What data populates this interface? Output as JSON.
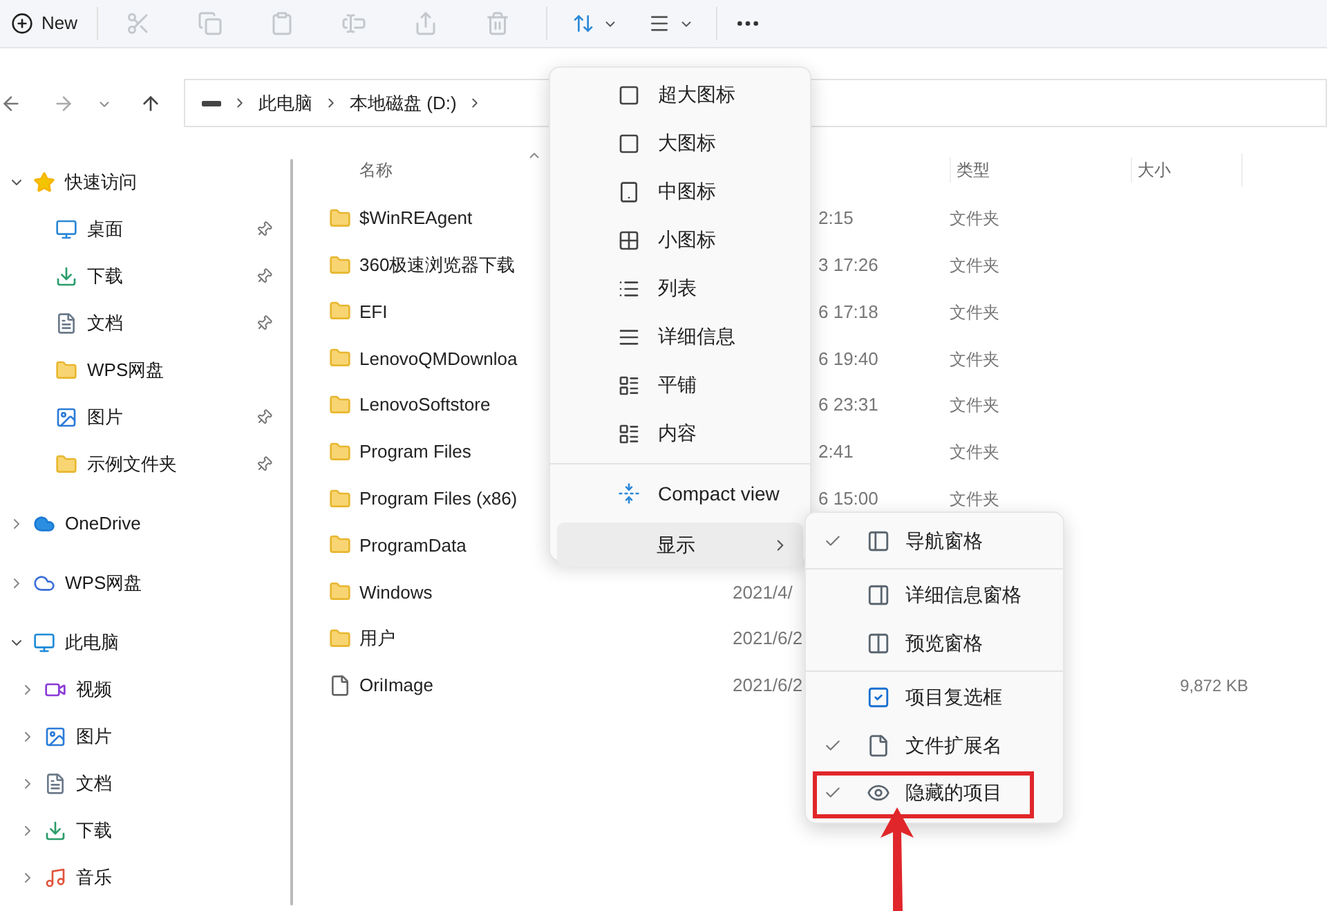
{
  "toolbar": {
    "new_label": "New",
    "tools": [
      {
        "disabled": true
      },
      {
        "disabled": true
      },
      {
        "disabled": true
      },
      {
        "disabled": true
      },
      {
        "disabled": true
      },
      {
        "disabled": true
      }
    ],
    "sort_open": false,
    "view_open": true
  },
  "address": {
    "segments": [
      "此电脑",
      "本地磁盘 (D:)"
    ]
  },
  "sidebar": {
    "items": [
      {
        "label": "快速访问",
        "kind": "star",
        "expanded": true,
        "children": [
          {
            "label": "桌面",
            "kind": "desktop",
            "pinned": true
          },
          {
            "label": "下载",
            "kind": "download",
            "pinned": true
          },
          {
            "label": "文档",
            "kind": "document",
            "pinned": true
          },
          {
            "label": "WPS网盘",
            "kind": "folder",
            "pinned": false
          },
          {
            "label": "图片",
            "kind": "picture",
            "pinned": true
          },
          {
            "label": "示例文件夹",
            "kind": "folder",
            "pinned": true
          }
        ]
      },
      {
        "label": "OneDrive",
        "kind": "cloud",
        "expanded": false
      },
      {
        "label": "WPS网盘",
        "kind": "wps",
        "expanded": false
      },
      {
        "label": "此电脑",
        "kind": "pc",
        "expanded": true,
        "children": [
          {
            "label": "视频",
            "kind": "video",
            "expanded": false
          },
          {
            "label": "图片",
            "kind": "picture",
            "expanded": false
          },
          {
            "label": "文档",
            "kind": "document",
            "expanded": false
          },
          {
            "label": "下载",
            "kind": "download",
            "expanded": false
          },
          {
            "label": "音乐",
            "kind": "music",
            "expanded": false
          }
        ]
      }
    ]
  },
  "table": {
    "columns": [
      "名称",
      "类型",
      "大小"
    ],
    "rows": [
      {
        "name": "$WinREAgent",
        "kind": "folder",
        "date": "2:15",
        "type": "文件夹"
      },
      {
        "name": "360极速浏览器下载",
        "kind": "folder",
        "date": "3 17:26",
        "type": "文件夹"
      },
      {
        "name": "EFI",
        "kind": "folder",
        "date": "6 17:18",
        "type": "文件夹"
      },
      {
        "name": "LenovoQMDownloa",
        "kind": "folder",
        "date": "6 19:40",
        "type": "文件夹"
      },
      {
        "name": "LenovoSoftstore",
        "kind": "folder",
        "date": "6 23:31",
        "type": "文件夹"
      },
      {
        "name": "Program Files",
        "kind": "folder",
        "date": "2:41",
        "type": "文件夹"
      },
      {
        "name": "Program Files (x86)",
        "kind": "folder",
        "date": "6 15:00",
        "type": "文件夹"
      },
      {
        "name": "ProgramData",
        "kind": "folder"
      },
      {
        "name": "Windows",
        "kind": "folder",
        "date": "2021/4/"
      },
      {
        "name": "用户",
        "kind": "folder",
        "date": "2021/6/2"
      },
      {
        "name": "OriImage",
        "kind": "file",
        "date": "2021/6/2",
        "size": "9,872 KB"
      }
    ]
  },
  "view_menu": {
    "items": [
      {
        "label": "超大图标",
        "kind": "xl"
      },
      {
        "label": "大图标",
        "kind": "large"
      },
      {
        "label": "中图标",
        "kind": "medium"
      },
      {
        "label": "小图标",
        "kind": "small"
      },
      {
        "label": "列表",
        "kind": "list"
      },
      {
        "label": "详细信息",
        "kind": "details"
      },
      {
        "label": "平铺",
        "kind": "tiles"
      },
      {
        "label": "内容",
        "kind": "content"
      }
    ],
    "compact": {
      "label": "Compact view"
    },
    "show": {
      "label": "显示",
      "selected": true
    },
    "submenu": {
      "groups": [
        [
          {
            "label": "导航窗格",
            "kind": "nav",
            "checked": true
          }
        ],
        [
          {
            "label": "详细信息窗格",
            "kind": "details",
            "checked": false
          },
          {
            "label": "预览窗格",
            "kind": "preview",
            "checked": false
          }
        ],
        [
          {
            "label": "项目复选框",
            "kind": "checkbox",
            "checked": false
          },
          {
            "label": "文件扩展名",
            "kind": "ext",
            "checked": true
          },
          {
            "label": "隐藏的项目",
            "kind": "hidden",
            "checked": true,
            "highlighted": true
          }
        ]
      ]
    }
  }
}
